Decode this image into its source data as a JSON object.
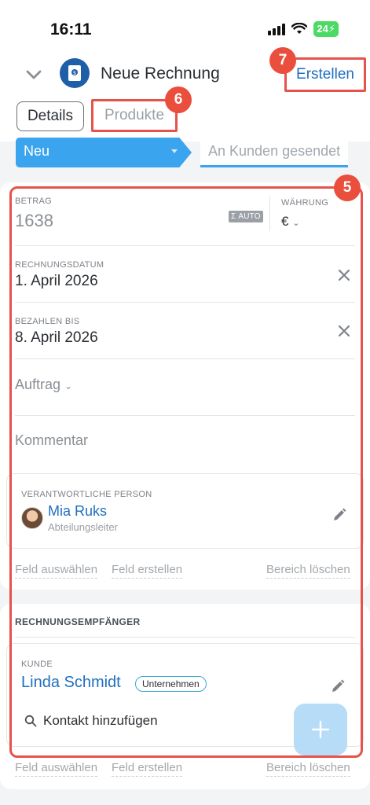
{
  "status": {
    "time": "16:11",
    "battery": "24"
  },
  "header": {
    "title": "Neue Rechnung",
    "create_label": "Erstellen",
    "badge_create": "7",
    "badge_products": "6",
    "tabs": {
      "details": "Details",
      "products": "Produkte"
    }
  },
  "stages": {
    "current": "Neu",
    "next": "An Kunden gesendet"
  },
  "main": {
    "badge": "5",
    "amount_caption": "BETRAG",
    "amount_value": "1638",
    "auto_label": "Σ AUTO",
    "currency_caption": "WÄHRUNG",
    "currency_value": "€",
    "invoice_date_caption": "RECHNUNGSDATUM",
    "invoice_date_value": "1. April 2026",
    "due_caption": "BEZAHLEN BIS",
    "due_value": "8. April 2026",
    "order_label": "Auftrag",
    "comment_label": "Kommentar",
    "responsible_caption": "VERANTWORTLICHE PERSON",
    "responsible_name": "Mia Ruks",
    "responsible_role": "Abteilungsleiter",
    "actions": {
      "select": "Feld auswählen",
      "create": "Feld erstellen",
      "delete": "Bereich löschen"
    }
  },
  "recipient": {
    "section_title": "RECHNUNGSEMPFÄNGER",
    "client_caption": "KUNDE",
    "client_name": "Linda Schmidt",
    "client_tag": "Unternehmen",
    "add_contact": "Kontakt hinzufügen",
    "actions": {
      "select": "Feld auswählen",
      "create": "Feld erstellen",
      "delete": "Bereich löschen"
    }
  },
  "colors": {
    "accent": "#1f6fbf",
    "stage": "#3aa4ef",
    "annotation": "#e5534b"
  }
}
